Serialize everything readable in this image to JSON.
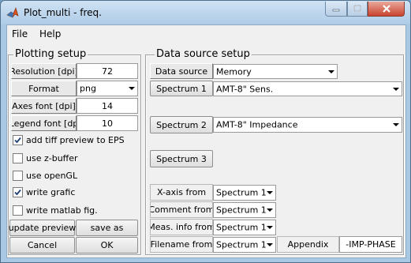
{
  "window": {
    "title": "Plot_multi - freq."
  },
  "menu": {
    "file": "File",
    "help": "Help"
  },
  "plotting": {
    "title": "Plotting setup",
    "resolution_label": "Resolution [dpi]",
    "resolution_value": "72",
    "format_label": "Format",
    "format_value": "png",
    "axes_font_label": "Axes font [dpi]",
    "axes_font_value": "14",
    "legend_font_label": "Legend font [dp",
    "legend_font_value": "10",
    "checkboxes": [
      {
        "label": "add tiff preview to EPS",
        "checked": true
      },
      {
        "label": "use z-buffer",
        "checked": false
      },
      {
        "label": "use openGL",
        "checked": false
      },
      {
        "label": "write grafic",
        "checked": true
      },
      {
        "label": "write matlab fig.",
        "checked": false
      }
    ],
    "update_preview": "update preview",
    "save_as": "save as",
    "cancel": "Cancel",
    "ok": "OK"
  },
  "datasource": {
    "title": "Data source setup",
    "source_label": "Data source",
    "source_value": "Memory",
    "spectrum1_label": "Spectrum 1",
    "spectrum1_value": "AMT-8\" Sens.",
    "spectrum2_label": "Spectrum 2",
    "spectrum2_value": "AMT-8\" Impedance",
    "spectrum3_label": "Spectrum 3",
    "xaxis_label": "X-axis from",
    "xaxis_value": "Spectrum 1",
    "comment_label": "Comment from",
    "comment_value": "Spectrum 1",
    "meas_label": "Meas. info from",
    "meas_value": "Spectrum 1",
    "filename_label": "Filename from",
    "filename_value": "Spectrum 1",
    "appendix_label": "Appendix",
    "appendix_value": "-IMP-PHASE"
  }
}
